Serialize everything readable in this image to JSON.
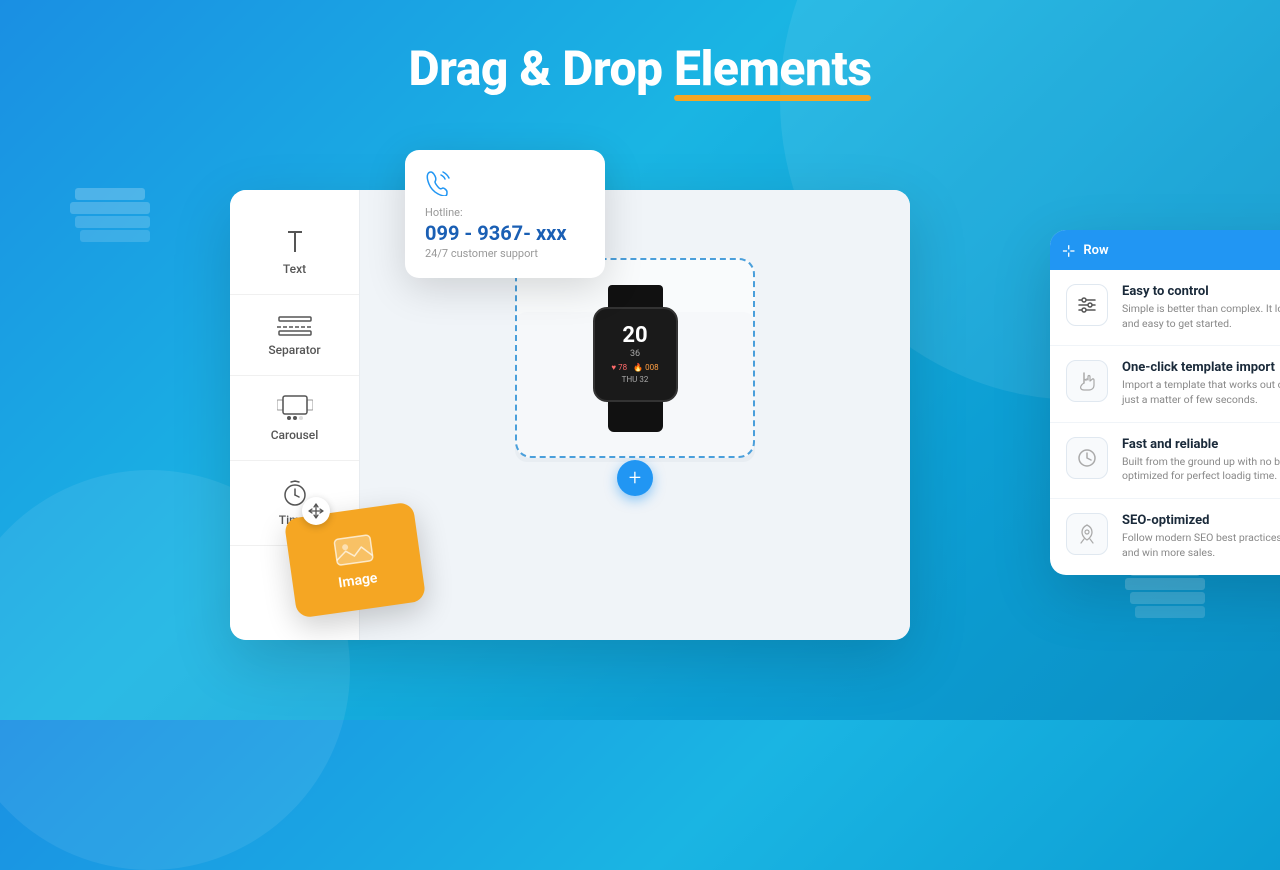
{
  "header": {
    "title_part1": "Drag & Drop ",
    "title_highlight": "Elements"
  },
  "hotline": {
    "label": "Hotline:",
    "number": "099 - 9367- xxx",
    "support": "24/7 customer support"
  },
  "sidebar": {
    "items": [
      {
        "id": "text",
        "label": "Text"
      },
      {
        "id": "separator",
        "label": "Separator"
      },
      {
        "id": "carousel",
        "label": "Carousel"
      },
      {
        "id": "timer",
        "label": "Timer"
      }
    ]
  },
  "toolbar": {
    "row_label": "Row",
    "move_icon": "⊹",
    "download_icon": "↓",
    "copy_icon": "⧉",
    "close_icon": "×"
  },
  "features": [
    {
      "id": "easy-control",
      "title": "Easy to control",
      "description": "Simple is better than complex. It looks intuitive and easy to get started."
    },
    {
      "id": "one-click-import",
      "title": "One-click template import",
      "description": "Import a template that works out of the box, just a matter of few seconds."
    },
    {
      "id": "fast-reliable",
      "title": "Fast and reliable",
      "description": "Built from the ground up with no bloat, optimized for perfect loadig time."
    },
    {
      "id": "seo-optimized",
      "title": "SEO-optimized",
      "description": "Follow modern SEO best practices, drive traffic and win more sales."
    }
  ],
  "draggable": {
    "label": "Image"
  },
  "colors": {
    "accent_blue": "#2196F3",
    "accent_orange": "#f5a623",
    "text_dark": "#1a2a3a",
    "text_muted": "#888888"
  }
}
